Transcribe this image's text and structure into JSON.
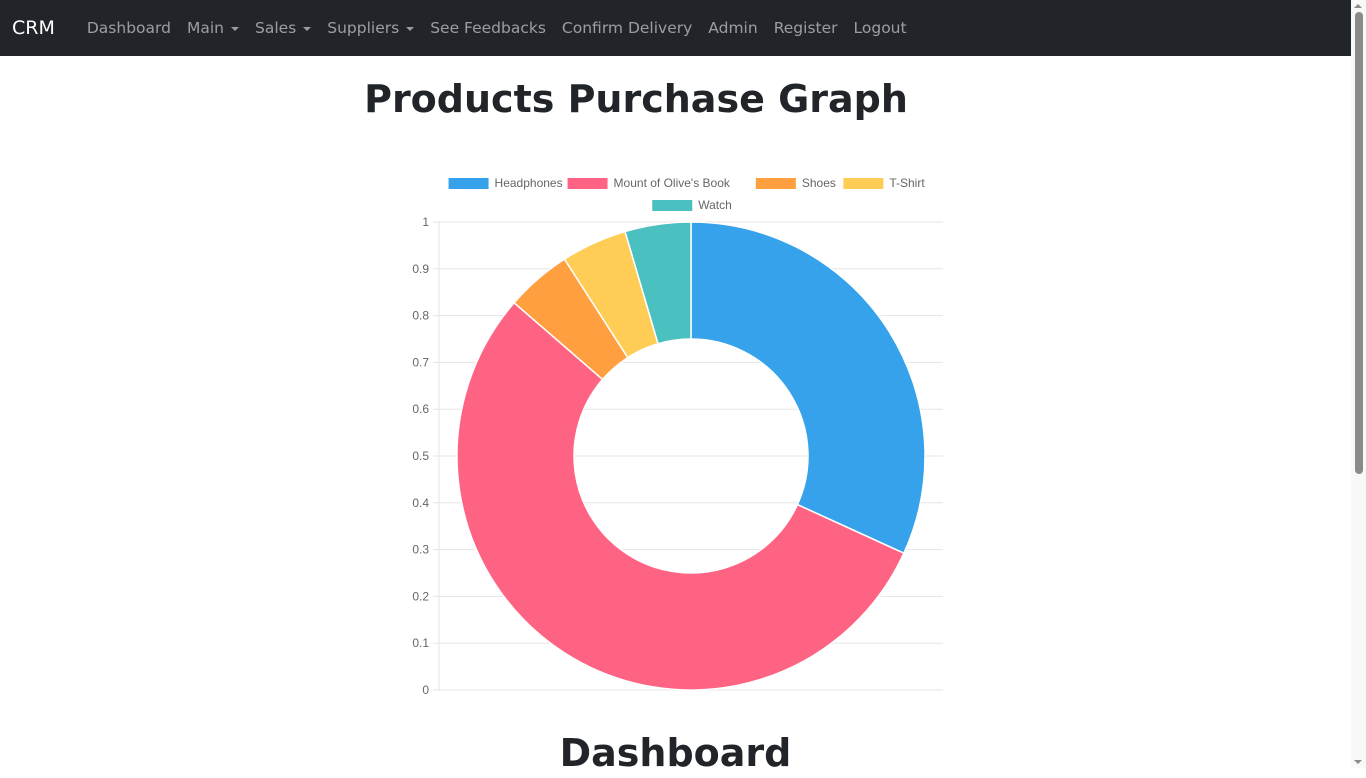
{
  "navbar": {
    "brand": "CRM",
    "items": [
      {
        "label": "Dashboard",
        "dropdown": false
      },
      {
        "label": "Main",
        "dropdown": true
      },
      {
        "label": "Sales",
        "dropdown": true
      },
      {
        "label": "Suppliers",
        "dropdown": true
      },
      {
        "label": "See Feedbacks",
        "dropdown": false
      },
      {
        "label": "Confirm Delivery",
        "dropdown": false
      },
      {
        "label": "Admin",
        "dropdown": false
      },
      {
        "label": "Register",
        "dropdown": false
      },
      {
        "label": "Logout",
        "dropdown": false
      }
    ]
  },
  "page": {
    "title": "Products Purchase Graph",
    "section_title": "Dashboard"
  },
  "chart_data": {
    "type": "pie",
    "variant": "doughnut",
    "title": "",
    "categories": [
      "Headphones",
      "Mount of Olive's Book",
      "Shoes",
      "T-Shirt",
      "Watch"
    ],
    "values": [
      7,
      12,
      1,
      1,
      1
    ],
    "colors": [
      "#36a2eb",
      "#ff6384",
      "#ff9f40",
      "#ffcd56",
      "#4bc0c0"
    ],
    "legend_position": "top",
    "yaxis_ticks": [
      "0",
      "0.1",
      "0.2",
      "0.3",
      "0.4",
      "0.5",
      "0.6",
      "0.7",
      "0.8",
      "0.9",
      "1"
    ],
    "ylim": [
      0,
      1
    ],
    "grid": true,
    "xlabel": "",
    "ylabel": ""
  }
}
